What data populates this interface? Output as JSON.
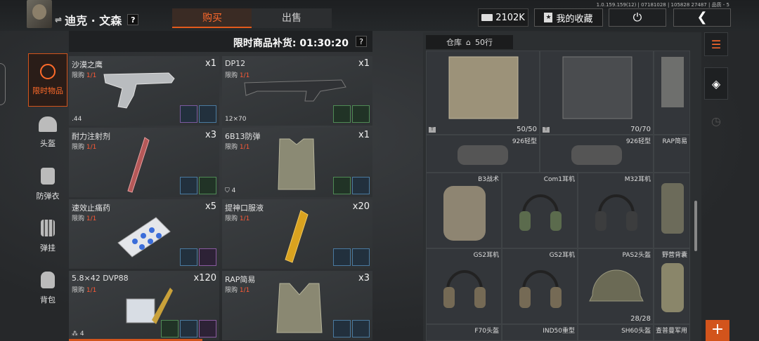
{
  "player": {
    "name": "迪克 · 文森",
    "help": "?"
  },
  "tabs": {
    "buy": "购买",
    "sell": "出售"
  },
  "wallet": {
    "amount": "2102K"
  },
  "favorites": {
    "label": "我的收藏"
  },
  "version_text": "1.0.159.159(12) | 07181028 | 105828 27487 | 品质 - 5",
  "restock": {
    "label": "限时商品补货: 01:30:20",
    "help": "?"
  },
  "sidebar": {
    "items": [
      {
        "label": "限时物品",
        "icon": "clock-icon",
        "active": true
      },
      {
        "label": "头盔",
        "icon": "helmet-icon"
      },
      {
        "label": "防弹衣",
        "icon": "vest-icon"
      },
      {
        "label": "弹挂",
        "icon": "rig-icon"
      },
      {
        "label": "背包",
        "icon": "backpack-icon"
      }
    ]
  },
  "shop_items": [
    {
      "name": "沙漠之鹰",
      "limit_prefix": "限购",
      "limit": "1/1",
      "qty": "x1",
      "caliber": ".44"
    },
    {
      "name": "DP12",
      "limit_prefix": "限购",
      "limit": "1/1",
      "qty": "x1",
      "caliber": "12×70"
    },
    {
      "name": "耐力注射剂",
      "limit_prefix": "限购",
      "limit": "1/1",
      "qty": "x3",
      "caliber": ""
    },
    {
      "name": "6B13防弹",
      "limit_prefix": "限购",
      "limit": "1/1",
      "qty": "x1",
      "caliber": "4"
    },
    {
      "name": "速效止痛药",
      "limit_prefix": "限购",
      "limit": "1/1",
      "qty": "x5",
      "caliber": ""
    },
    {
      "name": "提神口服液",
      "limit_prefix": "限购",
      "limit": "1/1",
      "qty": "x20",
      "caliber": ""
    },
    {
      "name": "5.8×42 DVP88",
      "limit_prefix": "限购",
      "limit": "1/1",
      "qty": "x120",
      "caliber": "4"
    },
    {
      "name": "RAP简易",
      "limit_prefix": "限购",
      "limit": "1/1",
      "qty": "x3",
      "caliber": ""
    }
  ],
  "stash": {
    "title": "仓库",
    "rows_label": "50行",
    "cells": [
      {
        "label": "",
        "bottom": "50/50"
      },
      {
        "label": "",
        "bottom": "70/70"
      },
      {
        "label": "",
        "bottom": ""
      },
      {
        "label": "926轻型",
        "bottom": ""
      },
      {
        "label": "926轻型",
        "bottom": ""
      },
      {
        "label": "RAP简易",
        "bottom": ""
      },
      {
        "label": "B3战术",
        "bottom": ""
      },
      {
        "label": "Com1耳机",
        "bottom": ""
      },
      {
        "label": "M32耳机",
        "bottom": ""
      },
      {
        "label": "",
        "bottom": ""
      },
      {
        "label": "GS2耳机",
        "bottom": ""
      },
      {
        "label": "GS2耳机",
        "bottom": ""
      },
      {
        "label": "PAS2头盔",
        "bottom": "28/28"
      },
      {
        "label": "野营背囊",
        "bottom": ""
      },
      {
        "label": "F70头盔",
        "bottom": ""
      },
      {
        "label": "IND50重型",
        "bottom": ""
      },
      {
        "label": "SH60头盔",
        "bottom": ""
      },
      {
        "label": "查普曼军用",
        "bottom": ""
      }
    ]
  },
  "colors": {
    "accent": "#d2541c",
    "limit": "#ff5a36"
  }
}
